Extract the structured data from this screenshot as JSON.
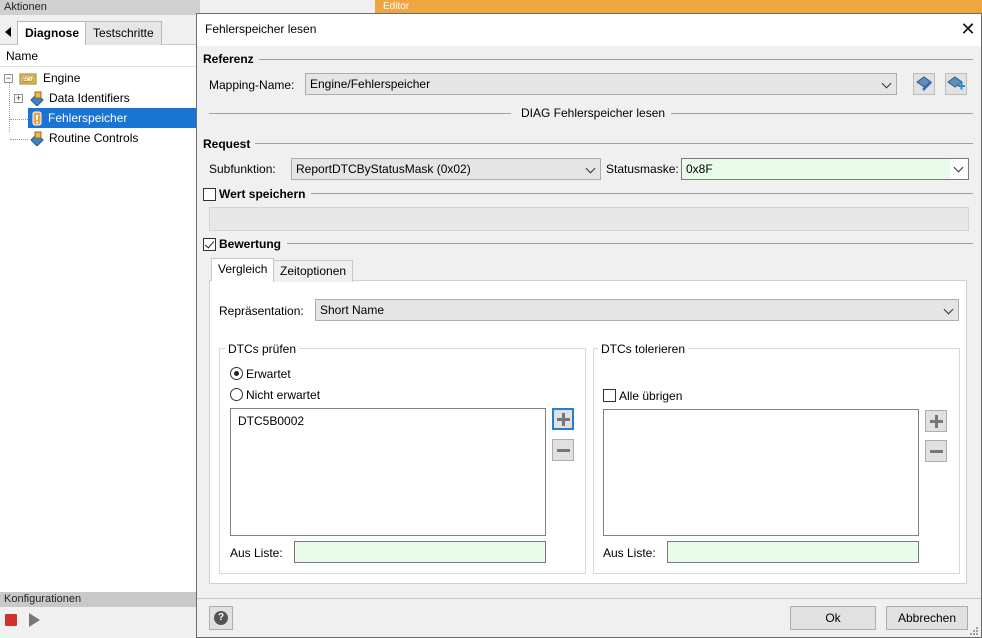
{
  "left": {
    "title": "Aktionen",
    "tabs": [
      "Diagnose",
      "Testschritte"
    ],
    "tree_header": "Name",
    "tree": [
      {
        "label": "Engine"
      },
      {
        "label": "Data Identifiers"
      },
      {
        "label": "Fehlerspeicher"
      },
      {
        "label": "Routine Controls"
      }
    ],
    "konfig_title": "Konfigurationen"
  },
  "editor_title": "Editor",
  "dialog": {
    "title": "Fehlerspeicher lesen",
    "close": "✕",
    "referenz": {
      "title": "Referenz",
      "mapping_label": "Mapping-Name:",
      "mapping_value": "Engine/Fehlerspeicher",
      "divider_text": "DIAG Fehlerspeicher lesen"
    },
    "request": {
      "title": "Request",
      "subfunktion_label": "Subfunktion:",
      "subfunktion_value": "ReportDTCByStatusMask (0x02)",
      "statusmaske_label": "Statusmaske:",
      "statusmaske_value": "0x8F"
    },
    "wert_speichern": {
      "label": "Wert speichern",
      "checked": false
    },
    "bewertung": {
      "label": "Bewertung",
      "checked": true
    },
    "tabs": [
      "Vergleich",
      "Zeitoptionen"
    ],
    "representation": {
      "label": "Repräsentation:",
      "value": "Short Name"
    },
    "dtcs_pruefen": {
      "title": "DTCs prüfen",
      "radio_erwartet": "Erwartet",
      "radio_nicht": "Nicht erwartet",
      "selected": "Erwartet",
      "items": [
        "DTC5B0002"
      ],
      "aus_liste_label": "Aus Liste:",
      "aus_liste_value": ""
    },
    "dtcs_tolerieren": {
      "title": "DTCs tolerieren",
      "alle_uebrigen": "Alle übrigen",
      "alle_checked": false,
      "items": [],
      "aus_liste_label": "Aus Liste:",
      "aus_liste_value": ""
    },
    "buttons": {
      "help": "?",
      "ok": "Ok",
      "cancel": "Abbrechen"
    }
  }
}
